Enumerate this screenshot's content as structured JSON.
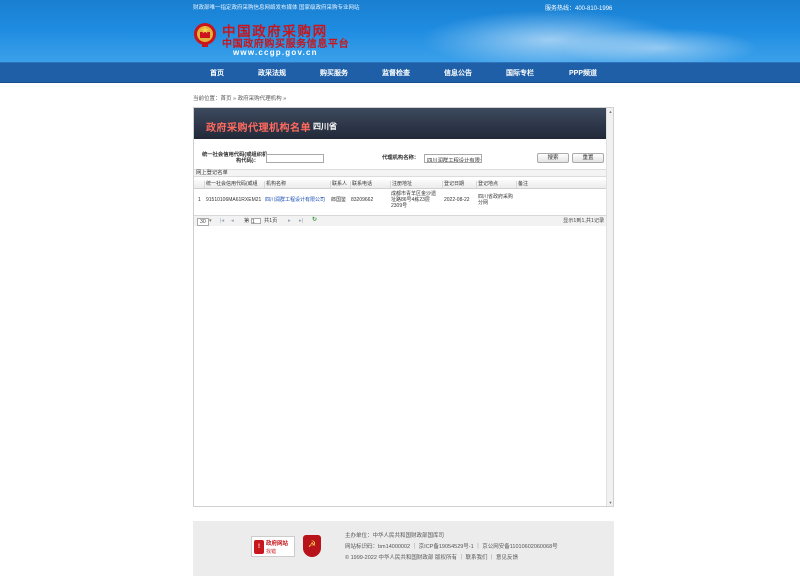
{
  "header": {
    "notice": "财政部唯一指定政府采购信息网络发布媒体 国家级政府采购专业网站",
    "hotline": "服务热线：400-810-1996",
    "title": "中国政府采购网",
    "subtitle": "中国政府购买服务信息平台",
    "url": "www.ccgp.gov.cn"
  },
  "nav": {
    "items": [
      "首页",
      "政采法规",
      "购买服务",
      "监督检查",
      "信息公告",
      "国际专栏",
      "PPP频道"
    ]
  },
  "breadcrumb": "当前位置：首页 » 政府采购代理机构 »",
  "banner": {
    "title": "政府采购代理机构名单",
    "province": "四川省"
  },
  "search": {
    "credit_label_1": "统一社会信用代码(或组织机",
    "credit_label_2": "构代码)：",
    "credit_value": "",
    "agency_label": "代理机构名称：",
    "agency_value": "四川润群工程设计有限公",
    "search_button": "搜索",
    "reset_button": "重置"
  },
  "grid": {
    "title": "网上登记名单",
    "columns": [
      "统一社会信用代码(或组",
      "机构名称",
      "联系人",
      "联系电话",
      "注册地址",
      "登记日期",
      "登记地点",
      "备注"
    ],
    "rows": [
      {
        "index": "1",
        "credit_code": "91510106MA61RXEM21",
        "name": "四川润群工程设计有限公司",
        "contact": "郎国鉴",
        "phone": "83209662",
        "address_1": "成都市青羊区金沙遗",
        "address_2": "址路86号4栋23层",
        "address_3": "2309号",
        "date": "2022-08-22",
        "place_1": "四川省政府采购",
        "place_2": "分网",
        "remark": ""
      }
    ],
    "pager": {
      "page_size": "30",
      "page_prefix": "第",
      "page_value": "1",
      "page_suffix": "共1页",
      "summary": "显示1到1,共1记录"
    }
  },
  "footer": {
    "gov_badge_1": "政府网站",
    "gov_badge_2": "找错",
    "sponsor": "主办单位：中华人民共和国财政部国库司",
    "record": "网站标识码：bm14000002 ｜ 京ICP备19054529号-1 ｜ 京公网安备11010602060068号",
    "copyright": "© 1999-2022 中华人民共和国财政部 版权所有 ｜ 联系我们 ｜ 意见反馈"
  },
  "colors": {
    "header_blue": "#1e8be0",
    "nav_blue": "#1f5fa8",
    "brand_red": "#c9151b",
    "banner_dark": "#2c3547",
    "banner_title": "#ff6a5e"
  }
}
